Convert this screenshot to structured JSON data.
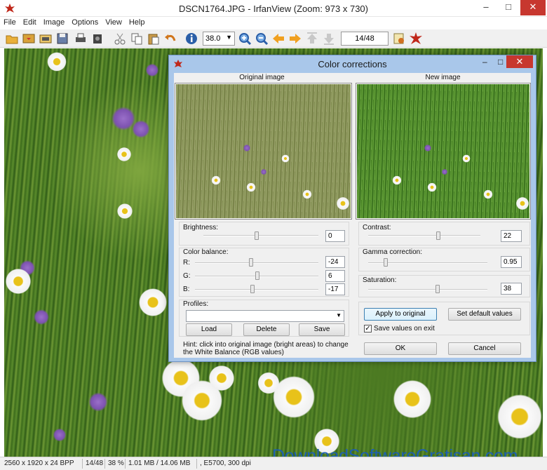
{
  "app": {
    "title": "DSCN1764.JPG - IrfanView (Zoom: 973 x 730)",
    "window_controls": {
      "minimize": "–",
      "maximize": "□",
      "close": "✕"
    }
  },
  "menu": [
    "File",
    "Edit",
    "Image",
    "Options",
    "View",
    "Help"
  ],
  "toolbar": {
    "zoom_value": "38.0",
    "page_counter": "14/48",
    "icons": [
      "open-icon",
      "thumbnails-icon",
      "slideshow-icon",
      "save-icon",
      "print-icon",
      "scanner-icon",
      "cut-icon",
      "copy-icon",
      "paste-icon",
      "undo-icon",
      "info-icon",
      "zoom-in-icon",
      "zoom-out-icon",
      "previous-icon",
      "next-icon",
      "first-icon",
      "last-icon",
      "settings-icon",
      "irfanview-icon"
    ]
  },
  "status": {
    "dimensions": "2560 x 1920 x 24 BPP",
    "index": "14/48",
    "zoom": "38 %",
    "size": "1.01 MB / 14.06 MB",
    "extra": ", E5700, 300 dpi"
  },
  "watermark": "DownloadSoftwareGratisan.com",
  "dialog": {
    "title": "Color corrections",
    "original_label": "Original image",
    "new_label": "New image",
    "brightness": {
      "label": "Brightness:",
      "value": "0"
    },
    "color_balance": {
      "label": "Color balance:",
      "r_label": "R:",
      "r_value": "-24",
      "g_label": "G:",
      "g_value": "6",
      "b_label": "B:",
      "b_value": "-17"
    },
    "contrast": {
      "label": "Contrast:",
      "value": "22"
    },
    "gamma": {
      "label": "Gamma correction:",
      "value": "0.95"
    },
    "saturation": {
      "label": "Saturation:",
      "value": "38"
    },
    "profiles": {
      "label": "Profiles:",
      "selected": "",
      "load": "Load",
      "delete": "Delete",
      "save": "Save"
    },
    "hint": "Hint: click into original image (bright areas) to change the White Balance (RGB values)",
    "apply_to_original": "Apply to original",
    "set_default_values": "Set default values",
    "save_values_on_exit": "Save values on exit",
    "save_values_checked": true,
    "ok": "OK",
    "cancel": "Cancel"
  }
}
